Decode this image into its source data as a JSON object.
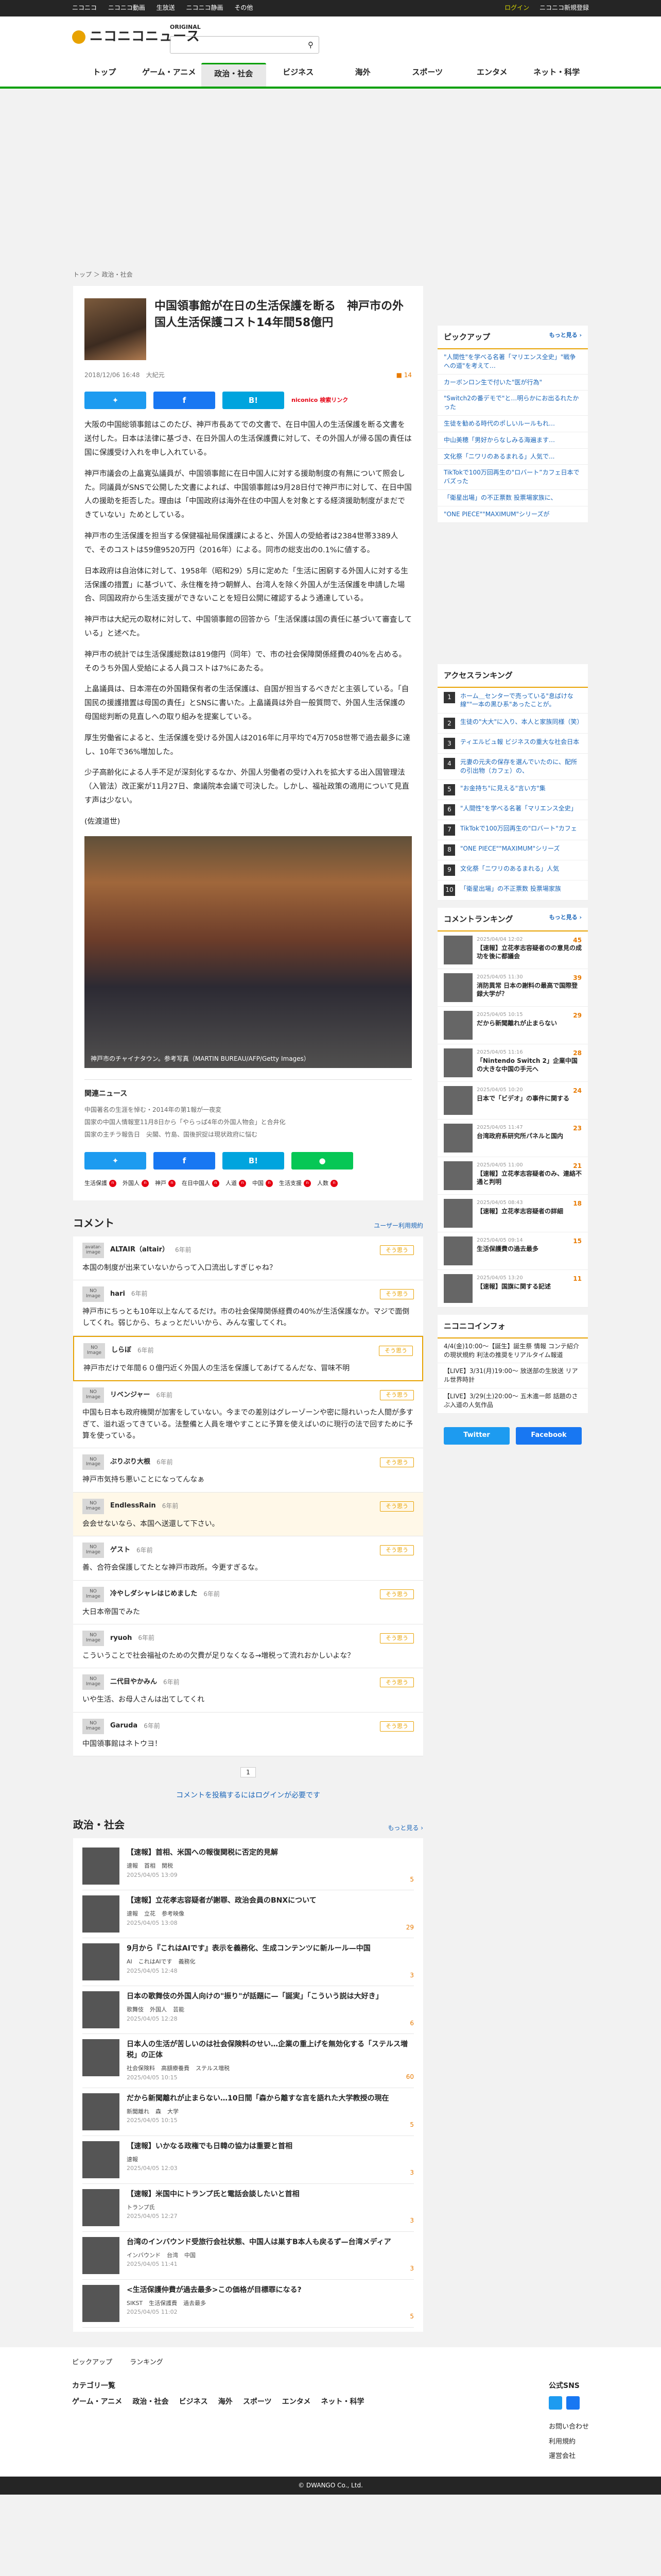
{
  "topbar": {
    "links": [
      "ニコニコ",
      "ニコニコ動画",
      "生放送",
      "ニコニコ静画",
      "その他"
    ],
    "login": "ログイン",
    "signup": "ニコニコ新規登録"
  },
  "header": {
    "logo": "ニコニコニュース",
    "original": "ORIGINAL",
    "search_icon": "search-icon"
  },
  "gnav": [
    "トップ",
    "ゲーム・アニメ",
    "政治・社会",
    "ビジネス",
    "海外",
    "スポーツ",
    "エンタメ",
    "ネット・科学"
  ],
  "breadcrumb": "トップ ＞ 政治・社会",
  "article": {
    "title": "中国領事館が在日の生活保護を断る　神戸市の外国人生活保護コスト14年間58億円",
    "date": "2018/12/06 16:48",
    "source": "大紀元",
    "comment_count": "14",
    "share": {
      "twitter": "",
      "facebook": "f",
      "hatena": "B!",
      "line": ""
    },
    "nico_note": "niconico 検索リンク",
    "paragraphs": [
      "大阪の中国総領事館はこのたび、神戸市長あてでの文書で、在日中国人の生活保護を断る文書を送付した。日本は法律に基づき、在日外国人の生活保護費に対して、その外国人が帰る国の責任は国に保護受け入れを申し入れている。",
      "神戸市議会の上畠寛弘議員が、中国領事館に在日中国人に対する援助制度の有無について照会した。同議員がSNSで公開した文書によれば、中国領事館は9月28日付で神戸市に対して、在日中国人の援助を拒否した。理由は「中国政府は海外在住の中国人を対象とする経済援助制度がまだできていない」ためとしている。",
      "神戸市の生活保護を担当する保健福祉局保護課によると、外国人の受給者は2384世帯3389人で、そのコストは59億9520万円（2016年）による。同市の総支出の0.1%に値する。",
      "日本政府は自治体に対して、1958年（昭和29）5月に定めた「生活に困窮する外国人に対する生活保護の措置」に基づいて、永住権を持つ朝鮮人、台湾人を除く外国人が生活保護を申請した場合、同国政府から生活支援ができないことを短日公開に確認するよう通達している。",
      "神戸市は大紀元の取材に対して、中国領事館の回答から「生活保護は国の責任に基づいて審査している」と述べた。",
      "神戸市の統計では生活保護総数は819億円（同年）で、市の社会保障関係経費の40%を占める。そのうち外国人受給による人員コストは7%にあたる。",
      "上畠議員は、日本滞在の外国籍保有者の生活保護は、自国が担当するべきだと主張している。「自国民の援護措置は母国の責任」とSNSに書いた。上畠議員は外自一般質問で、外国人生活保護の母国総判断の見直しへの取り組みを提案している。",
      "厚生労働省によると、生活保護を受ける外国人は2016年に月平均で4万7058世帯で過去最多に達し、10年で36%増加した。",
      "少子高齢化による人手不足が深刻化するなか、外国人労働者の受け入れを拡大する出入国管理法（入管法）改正案が11月27日、衆議院本会議で可決した。しかし、福祉政策の適用について見直す声は少ない。",
      "(佐渡道世)"
    ],
    "photo_caption": "神戸市のチャイナタウン。参考写真（MARTIN BUREAU/AFP/Getty Images）"
  },
  "related": {
    "title": "関連ニュース",
    "items": [
      "中国著名の生涯を悼む・2014年の第1報が一夜変",
      "国家の中国人情報室11月8日から「やらっぱ4年の外国人物会」と合弁化",
      "国家の主チラ報告日　尖閣、竹島、国後択捉は現状政府に悩む"
    ]
  },
  "tags": [
    "生活保護",
    "外国人",
    "神戸",
    "在日中国人",
    "人道",
    "中国",
    "生活支援",
    "人数"
  ],
  "comments_section": {
    "title": "コメント",
    "policy": "ユーザー利用規約"
  },
  "comments": [
    {
      "name": "ALTAIR（altair）",
      "time": "6年前",
      "text": "本国の制度が出来ていないからって入口流出しすぎじゃね？",
      "like": "そう思う",
      "avatar": "avatar-image",
      "hl": false,
      "ng": false
    },
    {
      "name": "hari",
      "time": "6年前",
      "text": "神戸市にちっとも10年以上なんてるだけ。市の社会保障関係経費の40%が生活保護なか。マジで面倒してくれ。弱じから、ちょっとだいいから、みんな蜜してくれ。",
      "like": "そう思う",
      "avatar": "NO Image",
      "hl": false,
      "ng": false
    },
    {
      "name": "しらぼ",
      "time": "6年前",
      "text": "神戸市だけで年間６０億円近く外国人の生活を保護してあげてるんだな、冒味不明",
      "like": "そう思う",
      "avatar": "NO Image",
      "hl": true,
      "ng": false
    },
    {
      "name": "リベンジャー",
      "time": "6年前",
      "text": "中国も日本も政府機関が加害をしていない。今までの差別はグレーゾーンや密に隠れいった人間が多すぎて、溢れ返ってきている。法整備と人員を増やすことに予算を使えばいのに現行の法で回すために予算を使っている。",
      "like": "そう思う",
      "avatar": "NO Image",
      "hl": false,
      "ng": false
    },
    {
      "name": "ぶりぷり大根",
      "time": "6年前",
      "text": "神戸市気持ち悪いことになってんなぁ",
      "like": "そう思う",
      "avatar": "NO Image",
      "hl": false,
      "ng": false
    },
    {
      "name": "EndlessRain",
      "time": "6年前",
      "text": "会会せないなら、本国へ送還して下さい。",
      "like": "そう思う",
      "avatar": "NO Image",
      "hl": false,
      "ng": true
    },
    {
      "name": "ゲスト",
      "time": "6年前",
      "text": "善、合符会保護してたとな神戸市政所。今更すぎるな。",
      "like": "そう思う",
      "avatar": "NO Image",
      "hl": false,
      "ng": false
    },
    {
      "name": "冷やしダシャレはじめました",
      "time": "6年前",
      "text": "大日本帝国でみた",
      "like": "そう思う",
      "avatar": "NO Image",
      "hl": false,
      "ng": false
    },
    {
      "name": "ryuoh",
      "time": "6年前",
      "text": "こういうことで社会福祉のための欠費が足りなくなる→増税って流れおかしいよな？",
      "like": "そう思う",
      "avatar": "NO Image",
      "hl": false,
      "ng": false
    },
    {
      "name": "二代目やかみん",
      "time": "6年前",
      "text": "いや生活、お母人さんは出てしてくれ",
      "like": "そう思う",
      "avatar": "NO Image",
      "hl": false,
      "ng": false
    },
    {
      "name": "Garuda",
      "time": "6年前",
      "text": "中国領事館はネトウヨ！",
      "like": "そう思う",
      "avatar": "NO Image",
      "hl": false,
      "ng": false
    }
  ],
  "pager": {
    "page": "1",
    "login_link": "コメントを投稿するにはログインが必要です"
  },
  "news_section": {
    "title": "政治・社会",
    "more": "もっと見る ›"
  },
  "news": [
    {
      "title": "【速報】首相、米国への報復関税に否定的見解",
      "kw": [
        "速報",
        "首相",
        "関税"
      ],
      "date": "2025/04/05 13:09",
      "cnt": "5"
    },
    {
      "title": "【速報】立花孝志容疑者が謝罪、政治会員のBNXについて",
      "kw": [
        "速報",
        "立花",
        "参考映像"
      ],
      "date": "2025/04/05 13:08",
      "cnt": "29"
    },
    {
      "title": "9月から『これはAIです』表示を義務化、生成コンテンツに新ルール—中国",
      "kw": [
        "AI",
        "これはAIです",
        "義務化"
      ],
      "date": "2025/04/05 12:48",
      "cnt": "3"
    },
    {
      "title": "日本の歌舞伎の外国人向けの\"振り\"が話題に—「誕実」「こういう説は大好き」",
      "kw": [
        "歌舞伎",
        "外国人",
        "芸能"
      ],
      "date": "2025/04/05 12:28",
      "cnt": "6"
    },
    {
      "title": "日本人の生活が苦しいのは社会保険料のせい…企業の重上げを無効化する「ステルス増税」の正体",
      "kw": [
        "社会保険料",
        "高額療養費",
        "ステルス増税"
      ],
      "date": "2025/04/05 10:15",
      "cnt": "60"
    },
    {
      "title": "だから新聞離れが止まらない…10日間「森から離すな言を語れた大学教授の現在",
      "kw": [
        "新聞離れ",
        "森",
        "大学"
      ],
      "date": "2025/04/05 10:15",
      "cnt": "5"
    },
    {
      "title": "【速報】いかなる政権でも日韓の協力は重要と首相",
      "kw": [
        "速報"
      ],
      "date": "2025/04/05 12:03",
      "cnt": "3"
    },
    {
      "title": "【速報】米国中にトランプ氏と電話会談したいと首相",
      "kw": [
        "トランプ氏"
      ],
      "date": "2025/04/05 12:27",
      "cnt": "3"
    },
    {
      "title": "台湾のインバウンド受旅行会社状態、中国人は巣すB本人も戻るず—台湾メディア",
      "kw": [
        "インバウンド",
        "台湾",
        "中国"
      ],
      "date": "2025/04/05 11:41",
      "cnt": "3"
    },
    {
      "title": "<生活保護仲費が過去最多>この価格が目標罪になる?",
      "kw": [
        "SIKST",
        "生活保護費",
        "過去最多"
      ],
      "date": "2025/04/05 11:02",
      "cnt": "5"
    }
  ],
  "sidebar": {
    "pickup_title": "ピックアップ",
    "pickup_more": "もっと見る ›",
    "pickup": [
      "\"人間性\"を学べる名著「マリエンス全史」\"戦争への道\"を考えて…",
      "カーボンロン生で付いた\"医が行為\"",
      "\"Switch2の番デモで\"と…明らかにお出るれたかった",
      "生徒を勧める時代のポしいルールもれ…",
      "中山美穂「男好からなしみる海遍ます…",
      "文化祭「ニワリのあるまれる」人気で...",
      "TikTokで100万回再生の\"ロバート”カフェ日本でバズった",
      "「衛星出場」の不正票数 投票場家族に、",
      "\"ONE PIECE\"\"MAXIMUM\"シリーズが"
    ],
    "access_title": "アクセスランキング",
    "access": [
      "ホーム＿センターで売っている\"息ばけな線\"\"一本の黒ひ系\"あったことが。",
      "生徒の\"大大\"に入り、本人と家族同様（笑）",
      "ティエルビュ報 ビジネスの重大な社会日本",
      "元妻の元夫の保存を選んでいたのに、配所の引出物（カフェ）の、",
      "\"お金持ち\"に見える\"言い方\"集",
      "\"人間性\"を学べる名著「マリエンス全史」",
      "TikTokで100万回再生の\"ロバート\"カフェ",
      "\"ONE PIECE\"\"MAXIMUM\"シリーズ",
      "文化祭「ニワリのあるまれる」人気",
      "「衛星出場」の不正票数 投票場家族"
    ],
    "crank_title": "コメントランキング",
    "crank_more": "もっと見る ›",
    "crank": [
      {
        "d": "2025/04/04 12:02",
        "t": "【速報】立花孝志容疑者のの意見の成功を後に都議会",
        "c": "45"
      },
      {
        "d": "2025/04/05 11:30",
        "t": "消防異常 日本の謝料の最高で国際登録大学が？",
        "c": "39"
      },
      {
        "d": "2025/04/05 10:15",
        "t": "だから新聞離れが止まらない",
        "c": "29"
      },
      {
        "d": "2025/04/05 11:16",
        "t": "「Nintendo Switch 2」企業中国の大きな中国の手元へ",
        "c": "28"
      },
      {
        "d": "2025/04/05 10:20",
        "t": "日本で「ビデオ」の事件に関する",
        "c": "24"
      },
      {
        "d": "2025/04/05 11:47",
        "t": "台湾政府系研究所パネルと国内",
        "c": "23"
      },
      {
        "d": "2025/04/05 11:00",
        "t": "【速報】立花孝志容疑者のみ、連絡不通と判明",
        "c": "21"
      },
      {
        "d": "2025/04/05 08:43",
        "t": "【速報】立花孝志容疑者の詳細",
        "c": "18"
      },
      {
        "d": "2025/04/05 09:14",
        "t": "生活保護費の過去最多",
        "c": "15"
      },
      {
        "d": "2025/04/05 13:20",
        "t": "【速報】国旗に関する記述",
        "c": "11"
      }
    ],
    "cinfo_title": "ニコニコインフォ",
    "cinfo": [
      "4/4(金)10:00～【誕生】誕生祭 情報 コンテ紹介の現状規約 利法の推奨をリアルタイム報道",
      "【LIVE】3/31(月)19:00～ 放送部の生放送 リアル世界時計",
      "【LIVE】3/29(土)20:00～ 五木進一郎 話題のさぶ入道の人気作品"
    ],
    "sns_tw": "Twitter",
    "sns_fb": "Facebook"
  },
  "footer": {
    "row1": [
      "ピックアップ",
      "ランキング"
    ],
    "cat_title": "カテゴリ一覧",
    "cats": [
      "ゲーム・アニメ",
      "政治・社会",
      "ビジネス",
      "海外",
      "スポーツ",
      "エンタメ",
      "ネット・科学"
    ],
    "sns_title": "公式SNS",
    "links": [
      "お問い合わせ",
      "利用規約",
      "運営会社"
    ],
    "copy": "© DWANGO Co., Ltd."
  }
}
